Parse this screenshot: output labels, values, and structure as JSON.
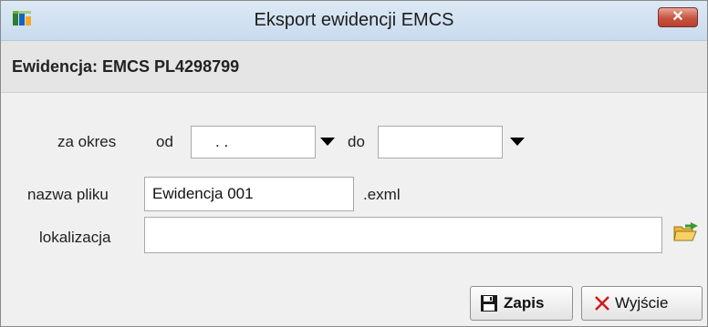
{
  "window": {
    "title": "Eksport ewidencji EMCS",
    "close_glyph": "✕"
  },
  "header": {
    "label": "Ewidencja: EMCS PL4298799"
  },
  "period": {
    "label": "za okres",
    "from_label": "od",
    "from_value": " . .",
    "to_label": "do",
    "to_value": ""
  },
  "file": {
    "label": "nazwa pliku",
    "value": "Ewidencja 001",
    "extension": ".exml"
  },
  "location": {
    "label": "lokalizacja",
    "value": ""
  },
  "buttons": {
    "save": "Zapis",
    "exit": "Wyjście"
  },
  "icons": {
    "app": "app-icon",
    "close": "close-icon",
    "dropdown": "chevron-down-icon",
    "folder": "folder-open-icon",
    "save": "floppy-disk-icon",
    "exit": "x-icon"
  },
  "colors": {
    "title_bar": "#c9dbee",
    "close_button": "#c6533f",
    "exit_icon": "#d11a1a"
  }
}
